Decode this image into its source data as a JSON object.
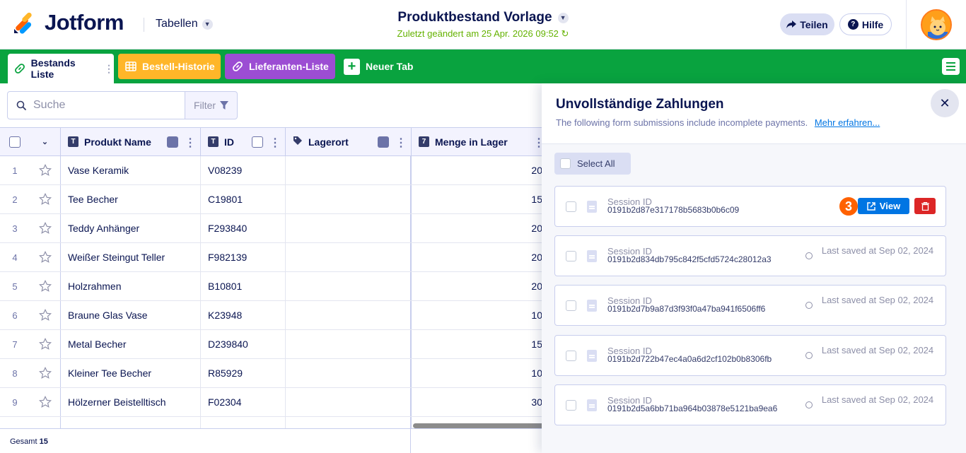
{
  "header": {
    "brand": "Jotform",
    "tables_label": "Tabellen",
    "doc_title": "Produktbestand Vorlage",
    "last_saved": "Zuletzt geändert am 25 Apr. 2026 09:52",
    "share_label": "Teilen",
    "help_label": "Hilfe"
  },
  "tabs": [
    {
      "label": "Bestands Liste",
      "color": "#ffffff",
      "icon": "link-icon"
    },
    {
      "label": "Bestell-Historie",
      "color": "#ffb629",
      "icon": "grid-icon"
    },
    {
      "label": "Lieferanten-Liste",
      "color": "#9c4dd3",
      "icon": "link-icon"
    },
    {
      "label": "Neuer Tab",
      "icon": "plus-icon"
    }
  ],
  "toolbar": {
    "search_placeholder": "Suche",
    "filter_label": "Filter"
  },
  "table": {
    "columns": [
      {
        "label": "Produkt Name",
        "type": "T"
      },
      {
        "label": "ID",
        "type": "T"
      },
      {
        "label": "Lagerort",
        "type": "tag"
      },
      {
        "label": "Menge in Lager",
        "type": "7"
      }
    ],
    "rows": [
      {
        "num": "1",
        "name": "Vase Keramik",
        "id": "V08239",
        "loc": "",
        "qty": "20"
      },
      {
        "num": "2",
        "name": "Tee Becher",
        "id": "C19801",
        "loc": "",
        "qty": "15"
      },
      {
        "num": "3",
        "name": "Teddy Anhänger",
        "id": "F293840",
        "loc": "",
        "qty": "20"
      },
      {
        "num": "4",
        "name": "Weißer Steingut Teller",
        "id": "F982139",
        "loc": "",
        "qty": "20"
      },
      {
        "num": "5",
        "name": "Holzrahmen",
        "id": "B10801",
        "loc": "",
        "qty": "20"
      },
      {
        "num": "6",
        "name": "Braune Glas Vase",
        "id": "K23948",
        "loc": "",
        "qty": "10"
      },
      {
        "num": "7",
        "name": "Metal Becher",
        "id": "D239840",
        "loc": "",
        "qty": "15"
      },
      {
        "num": "8",
        "name": "Kleiner Tee Becher",
        "id": "R85929",
        "loc": "",
        "qty": "10"
      },
      {
        "num": "9",
        "name": "Hölzerner Beistelltisch",
        "id": "F02304",
        "loc": "",
        "qty": "30"
      }
    ],
    "footer_label": "Gesamt",
    "footer_count": "15"
  },
  "panel": {
    "title": "Unvollständige Zahlungen",
    "subtitle": "The following form submissions include incomplete payments.",
    "learn_more": "Mehr erfahren...",
    "select_all": "Select All",
    "session_label": "Session ID",
    "view_label": "View",
    "step_badge": "3",
    "sessions": [
      {
        "id": "0191b2d87e317178b5683b0b6c09",
        "saved": ""
      },
      {
        "id": "0191b2d834db795c842f5cfd5724c28012a3",
        "saved": "Last saved at Sep 02, 2024"
      },
      {
        "id": "0191b2d7b9a87d3f93f0a47ba941f6506ff6",
        "saved": "Last saved at Sep 02, 2024"
      },
      {
        "id": "0191b2d722b47ec4a0a6d2cf102b0b8306fb",
        "saved": "Last saved at Sep 02, 2024"
      },
      {
        "id": "0191b2d5a6bb71ba964b03878e5121ba9ea6",
        "saved": "Last saved at Sep 02, 2024"
      }
    ]
  },
  "colors": {
    "brand_navy": "#0a1551",
    "tabbar_green": "#09a33f",
    "saved_green": "#64b200",
    "view_blue": "#0075e3",
    "delete_red": "#dc2626",
    "badge_orange": "#ff6100"
  }
}
